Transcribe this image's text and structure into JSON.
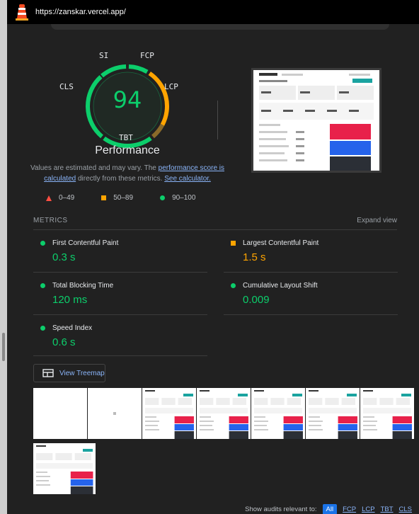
{
  "browser": {
    "url": "https://zanskar.vercel.app/"
  },
  "gauge": {
    "score": "94",
    "title": "Performance",
    "labels": {
      "si": "SI",
      "fcp": "FCP",
      "lcp": "LCP",
      "cls": "CLS",
      "tbt": "TBT"
    },
    "score_fraction": 0.94
  },
  "description": {
    "text1": "Values are estimated and may vary. The ",
    "link1": "performance score is calculated",
    "text2": " directly from these metrics. ",
    "link2": "See calculator."
  },
  "legend": {
    "fail": "0–49",
    "average": "50–89",
    "pass": "90–100"
  },
  "metrics": {
    "header": "METRICS",
    "expand": "Expand view",
    "items": [
      {
        "name": "First Contentful Paint",
        "value": "0.3 s",
        "status": "pass"
      },
      {
        "name": "Largest Contentful Paint",
        "value": "1.5 s",
        "status": "average"
      },
      {
        "name": "Total Blocking Time",
        "value": "120 ms",
        "status": "pass"
      },
      {
        "name": "Cumulative Layout Shift",
        "value": "0.009",
        "status": "pass"
      },
      {
        "name": "Speed Index",
        "value": "0.6 s",
        "status": "pass"
      }
    ]
  },
  "treemap": {
    "label": "View Treemap"
  },
  "audits": {
    "label": "Show audits relevant to:",
    "filters": [
      "All",
      "FCP",
      "LCP",
      "TBT",
      "CLS"
    ]
  },
  "colors": {
    "pass": "#0cce6b",
    "average": "#ffa400",
    "fail": "#ff4e42",
    "link": "#8ab4f8",
    "accent": "#1a73e8"
  }
}
